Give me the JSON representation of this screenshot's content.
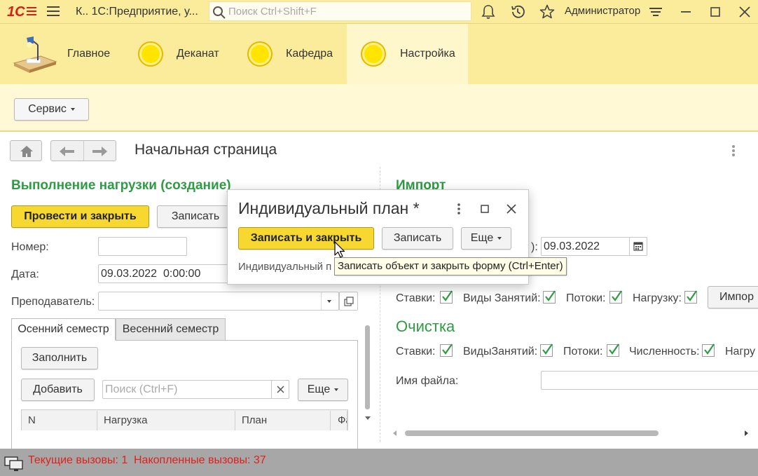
{
  "titlebar": {
    "logo_text": "1С",
    "window_title": "К.. 1С:Предприятие, у...",
    "search_placeholder": "Поиск Ctrl+Shift+F",
    "user": "Администратор"
  },
  "sections": [
    {
      "label": "Главное"
    },
    {
      "label": "Деканат"
    },
    {
      "label": "Кафедра"
    },
    {
      "label": "Настройка"
    }
  ],
  "cmdbar": {
    "service_label": "Сервис"
  },
  "page": {
    "title": "Начальная страница"
  },
  "left": {
    "heading": "Выполнение нагрузки (создание)",
    "post_close_label": "Провести и закрыть",
    "save_label": "Записать",
    "number_label": "Номер:",
    "number_value": "",
    "date_label": "Дата:",
    "date_value": "09.03.2022  0:00:00",
    "teacher_label": "Преподаватель:",
    "teacher_value": "",
    "tabs": [
      {
        "label": "Осенний семестр"
      },
      {
        "label": "Весенний семестр"
      }
    ],
    "fill_label": "Заполнить",
    "add_label": "Добавить",
    "search_placeholder": "Поиск (Ctrl+F)",
    "more_label": "Еще",
    "columns": [
      "N",
      "Нагрузка",
      "План",
      "Фа"
    ]
  },
  "right": {
    "import_heading": "Импорт",
    "date_suffix": "):",
    "date_value": "09.03.2022",
    "import_checks": [
      {
        "label": "Ставки:",
        "checked": true
      },
      {
        "label": "Виды Занятий:",
        "checked": true
      },
      {
        "label": "Потоки:",
        "checked": true
      },
      {
        "label": "Нагрузку:",
        "checked": true
      }
    ],
    "import_button": "Импор",
    "clear_heading": "Очистка",
    "clear_checks": [
      {
        "label": "Ставки:",
        "checked": true
      },
      {
        "label": "ВидыЗанятий:",
        "checked": true
      },
      {
        "label": "Потоки:",
        "checked": true
      },
      {
        "label": "Численность:",
        "checked": true
      },
      {
        "label": "Нагру",
        "checked": false
      }
    ],
    "filename_label": "Имя файла:",
    "filename_value": ""
  },
  "dialog": {
    "title": "Индивидуальный план *",
    "save_close_label": "Записать и закрыть",
    "save_label": "Записать",
    "more_label": "Еще",
    "field_label": "Индивидуальный п"
  },
  "tooltip": {
    "text": "Записать объект и закрыть форму (Ctrl+Enter)"
  },
  "statusbar": {
    "current_calls": "Текущие вызовы: 1",
    "accumulated_calls": "Накопленные вызовы: 37"
  },
  "colors": {
    "accent_yellow": "#fbec9c",
    "primary_button": "#f7d830",
    "heading_green": "#2f9b44",
    "status_red": "#e0201d",
    "logo_red": "#d4201b"
  }
}
